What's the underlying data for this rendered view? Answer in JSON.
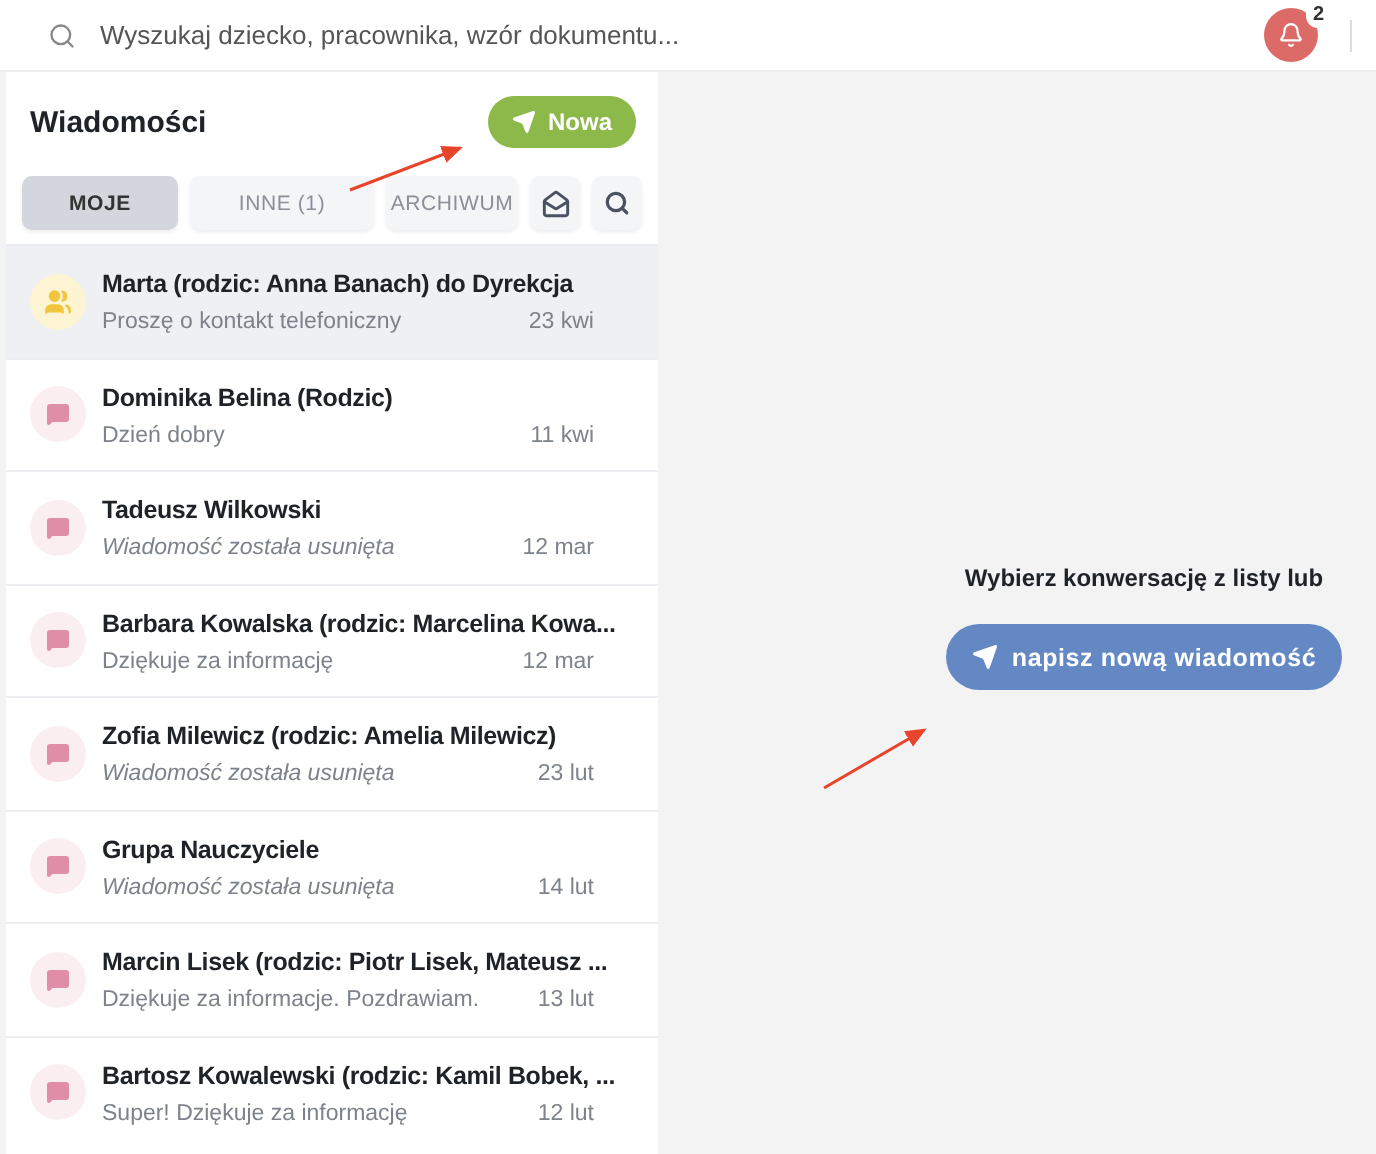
{
  "top_bar": {
    "search": {
      "placeholder": "Wyszukaj dziecko, pracownika, wzór dokumentu..."
    },
    "notifications": {
      "count": "2"
    }
  },
  "messages_panel": {
    "title": "Wiadomości",
    "new_button": "Nowa",
    "tabs": [
      {
        "label": "MOJE",
        "selected": true
      },
      {
        "label": "INNE (1)",
        "selected": false
      },
      {
        "label": "ARCHIWUM",
        "selected": false
      }
    ],
    "conversations": [
      {
        "kind": "group",
        "title": "Marta (rodzic: Anna Banach) do Dyrekcja",
        "preview": "Proszę o kontakt telefoniczny",
        "date": "23 kwi",
        "deleted": false,
        "selected": true
      },
      {
        "kind": "message",
        "title": "Dominika Belina (Rodzic)",
        "preview": "Dzień dobry",
        "date": "11 kwi",
        "deleted": false,
        "selected": false
      },
      {
        "kind": "message",
        "title": "Tadeusz Wilkowski",
        "preview": "Wiadomość została usunięta",
        "date": "12 mar",
        "deleted": true,
        "selected": false
      },
      {
        "kind": "message",
        "title": "Barbara Kowalska (rodzic: Marcelina Kowa...",
        "preview": "Dziękuje za informację",
        "date": "12 mar",
        "deleted": false,
        "selected": false
      },
      {
        "kind": "message",
        "title": "Zofia Milewicz (rodzic: Amelia Milewicz)",
        "preview": "Wiadomość została usunięta",
        "date": "23 lut",
        "deleted": true,
        "selected": false
      },
      {
        "kind": "message",
        "title": "Grupa Nauczyciele",
        "preview": "Wiadomość została usunięta",
        "date": "14 lut",
        "deleted": true,
        "selected": false
      },
      {
        "kind": "message",
        "title": "Marcin Lisek (rodzic: Piotr Lisek, Mateusz ...",
        "preview": "Dziękuje za informacje. Pozdrawiam.",
        "date": "13 lut",
        "deleted": false,
        "selected": false
      },
      {
        "kind": "message",
        "title": "Bartosz Kowalewski (rodzic: Kamil Bobek, ...",
        "preview": "Super! Dziękuje za informację",
        "date": "12 lut",
        "deleted": false,
        "selected": false
      }
    ]
  },
  "empty_state": {
    "prompt": "Wybierz konwersację z listy lub",
    "button": "napisz nową wiadomość"
  }
}
